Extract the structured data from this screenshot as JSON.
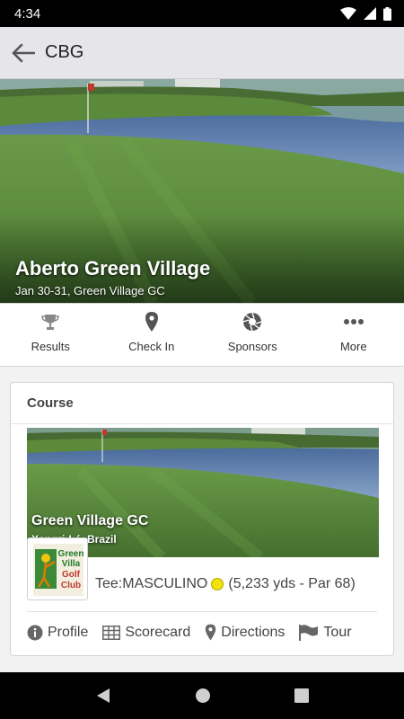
{
  "status": {
    "time": "4:34"
  },
  "app_bar": {
    "title": "CBG"
  },
  "event": {
    "title": "Aberto Green Village",
    "subtitle": "Jan 30-31, Green Village GC"
  },
  "actions": [
    {
      "label": "Results",
      "icon": "trophy-icon"
    },
    {
      "label": "Check In",
      "icon": "location-pin-icon"
    },
    {
      "label": "Sponsors",
      "icon": "aperture-icon"
    },
    {
      "label": "More",
      "icon": "more-dots-icon"
    }
  ],
  "course": {
    "section_title": "Course",
    "name": "Green Village GC",
    "location": "Xangri-Lá, Brazil",
    "logo_text": [
      "Green",
      "Villa",
      "Golf",
      "Club"
    ],
    "tee_prefix": "Tee: ",
    "tee_name": "MASCULINO",
    "tee_color": "#f2e20c",
    "tee_details": "(5,233 yds - Par 68)",
    "links": [
      {
        "label": "Profile",
        "icon": "info-icon"
      },
      {
        "label": "Scorecard",
        "icon": "table-icon"
      },
      {
        "label": "Directions",
        "icon": "location-pin-icon"
      },
      {
        "label": "Tour",
        "icon": "flag-icon"
      }
    ]
  },
  "nav": {
    "back": "back-triangle-icon",
    "home": "home-circle-icon",
    "recents": "recents-square-icon"
  }
}
